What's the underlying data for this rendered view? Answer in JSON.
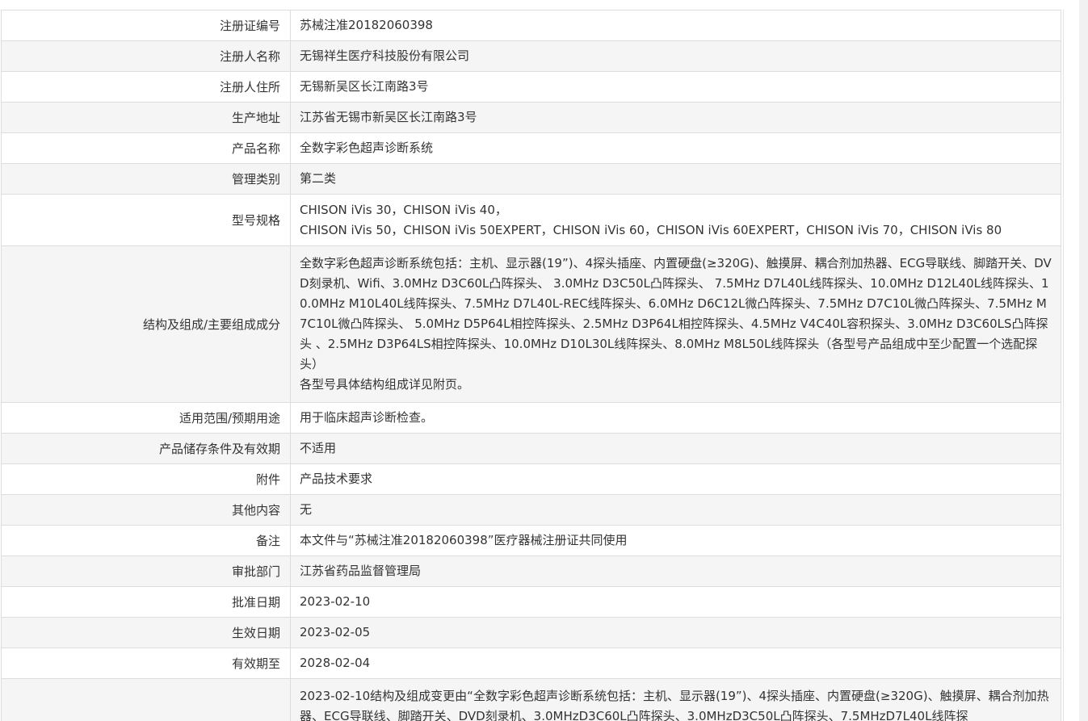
{
  "rows": [
    {
      "label": "注册证编号",
      "lines": [
        "苏械注准20182060398"
      ]
    },
    {
      "label": "注册人名称",
      "lines": [
        "无锡祥生医疗科技股份有限公司"
      ]
    },
    {
      "label": "注册人住所",
      "lines": [
        "无锡新吴区长江南路3号"
      ]
    },
    {
      "label": "生产地址",
      "lines": [
        "江苏省无锡市新吴区长江南路3号"
      ]
    },
    {
      "label": "产品名称",
      "lines": [
        "全数字彩色超声诊断系统"
      ]
    },
    {
      "label": "管理类别",
      "lines": [
        "第二类"
      ]
    },
    {
      "label": "型号规格",
      "lines": [
        "CHISON iVis 30，CHISON iVis 40，",
        "CHISON iVis 50，CHISON iVis 50EXPERT，CHISON iVis 60，CHISON iVis 60EXPERT，CHISON iVis 70，CHISON iVis 80"
      ]
    },
    {
      "label": "结构及组成/主要组成成分",
      "lines": [
        "全数字彩色超声诊断系统包括：主机、显示器(19”)、4探头插座、内置硬盘(≥320G)、触摸屏、耦合剂加热器、ECG导联线、脚踏开关、DVD刻录机、Wifi、3.0MHz D3C60L凸阵探头、 3.0MHz D3C50L凸阵探头、 7.5MHz D7L40L线阵探头、10.0MHz D12L40L线阵探头、10.0MHz M10L40L线阵探头、7.5MHz D7L40L-REC线阵探头、6.0MHz D6C12L微凸阵探头、7.5MHz D7C10L微凸阵探头、7.5MHz M7C10L微凸阵探头、 5.0MHz D5P64L相控阵探头、2.5MHz D3P64L相控阵探头、4.5MHz V4C40L容积探头、3.0MHz D3C60LS凸阵探头 、2.5MHz D3P64LS相控阵探头、10.0MHz D10L30L线阵探头、8.0MHz M8L50L线阵探头（各型号产品组成中至少配置一个选配探头）",
        "各型号具体结构组成详见附页。"
      ]
    },
    {
      "label": "适用范围/预期用途",
      "lines": [
        "用于临床超声诊断检查。"
      ]
    },
    {
      "label": "产品储存条件及有效期",
      "lines": [
        "不适用"
      ]
    },
    {
      "label": "附件",
      "lines": [
        "产品技术要求"
      ]
    },
    {
      "label": "其他内容",
      "lines": [
        "无"
      ]
    },
    {
      "label": "备注",
      "lines": [
        "本文件与“苏械注准20182060398”医疗器械注册证共同使用"
      ]
    },
    {
      "label": "审批部门",
      "lines": [
        "江苏省药品监督管理局"
      ]
    },
    {
      "label": "批准日期",
      "lines": [
        "2023-02-10"
      ]
    },
    {
      "label": "生效日期",
      "lines": [
        "2023-02-05"
      ]
    },
    {
      "label": "有效期至",
      "lines": [
        "2028-02-04"
      ]
    },
    {
      "label": "",
      "lines": [
        "2023-02-10结构及组成变更由“全数字彩色超声诊断系统包括：主机、显示器(19”)、4探头插座、内置硬盘(≥320G)、触摸屏、耦合剂加热器、ECG导联线、脚踏开关、DVD刻录机、3.0MHzD3C60L凸阵探头、3.0MHzD3C50L凸阵探头、7.5MHzD7L40L线阵探"
      ]
    }
  ]
}
